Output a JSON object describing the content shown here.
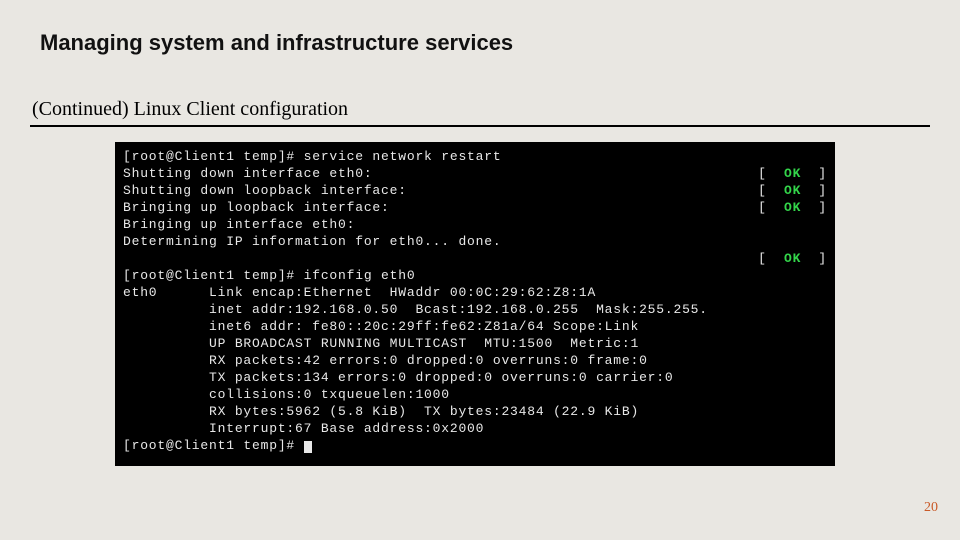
{
  "slide": {
    "title": "Managing system and infrastructure services",
    "subtitle": "(Continued) Linux Client configuration",
    "page_number": "20"
  },
  "terminal": {
    "lines": [
      {
        "left": "[root@Client1 temp]# service network restart",
        "status": null
      },
      {
        "left": "Shutting down interface eth0:",
        "status": "OK"
      },
      {
        "left": "Shutting down loopback interface:",
        "status": "OK"
      },
      {
        "left": "Bringing up loopback interface:",
        "status": "OK"
      },
      {
        "left": "Bringing up interface eth0:",
        "status": null
      },
      {
        "left": "Determining IP information for eth0... done.",
        "status": null
      },
      {
        "left": "",
        "status": "OK"
      },
      {
        "left": "[root@Client1 temp]# ifconfig eth0",
        "status": null
      },
      {
        "left": "eth0      Link encap:Ethernet  HWaddr 00:0C:29:62:Z8:1A",
        "status": null
      },
      {
        "left": "          inet addr:192.168.0.50  Bcast:192.168.0.255  Mask:255.255.",
        "status": null
      },
      {
        "left": "          inet6 addr: fe80::20c:29ff:fe62:Z81a/64 Scope:Link",
        "status": null
      },
      {
        "left": "          UP BROADCAST RUNNING MULTICAST  MTU:1500  Metric:1",
        "status": null
      },
      {
        "left": "          RX packets:42 errors:0 dropped:0 overruns:0 frame:0",
        "status": null
      },
      {
        "left": "          TX packets:134 errors:0 dropped:0 overruns:0 carrier:0",
        "status": null
      },
      {
        "left": "          collisions:0 txqueuelen:1000",
        "status": null
      },
      {
        "left": "          RX bytes:5962 (5.8 KiB)  TX bytes:23484 (22.9 KiB)",
        "status": null
      },
      {
        "left": "          Interrupt:67 Base address:0x2000",
        "status": null
      },
      {
        "left": "",
        "status": null
      },
      {
        "left": "[root@Client1 temp]# ",
        "status": null,
        "cursor": true
      }
    ],
    "status_left_bracket": "[  ",
    "status_right_bracket": "  ]",
    "ok_text": "OK"
  }
}
